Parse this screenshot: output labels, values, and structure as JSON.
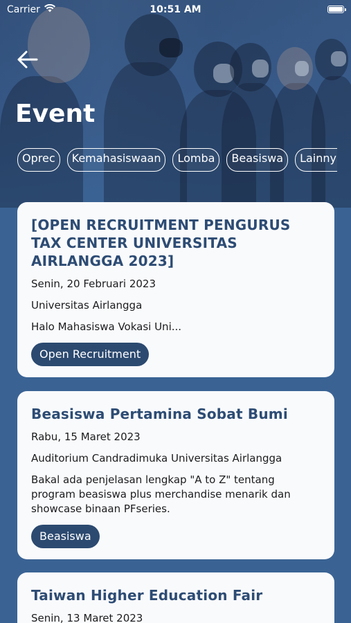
{
  "status_bar": {
    "carrier": "Carrier",
    "time": "10:51 AM"
  },
  "header": {
    "title": "Event",
    "back_icon": "arrow-left-icon"
  },
  "categories": [
    {
      "label": "Oprec"
    },
    {
      "label": "Kemahasiswaan"
    },
    {
      "label": "Lomba"
    },
    {
      "label": "Beasiswa"
    },
    {
      "label": "Lainnya"
    }
  ],
  "events": [
    {
      "title": "[OPEN RECRUITMENT PENGURUS TAX CENTER UNIVERSITAS AIRLANGGA 2023]",
      "date": "Senin, 20 Februari 2023",
      "location": "Universitas Airlangga",
      "description": "Halo Mahasiswa Vokasi Uni...",
      "tag": "Open Recruitment"
    },
    {
      "title": "Beasiswa Pertamina Sobat Bumi",
      "date": "Rabu, 15 Maret 2023",
      "location": "Auditorium Candradimuka Universitas Airlangga",
      "description": "Bakal ada penjelasan lengkap \"A to Z\" tentang program beasiswa plus merchandise menarik dan showcase binaan PFseries.",
      "tag": "Beasiswa"
    },
    {
      "title": "Taiwan Higher Education Fair",
      "date": "Senin, 13 Maret 2023"
    }
  ],
  "colors": {
    "background": "#3a6394",
    "card": "#f9fafc",
    "title_text": "#2d4c74",
    "tag_bg": "#2c4a70"
  }
}
